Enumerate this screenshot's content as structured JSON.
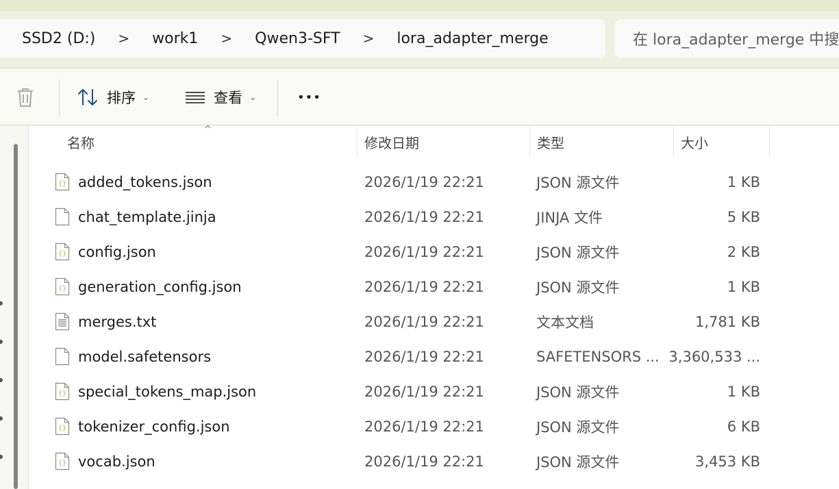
{
  "breadcrumb": [
    "SSD2 (D:)",
    "work1",
    "Qwen3-SFT",
    "lora_adapter_merge"
  ],
  "breadcrumb_separator": ">",
  "search": {
    "placeholder": "在 lora_adapter_merge 中搜"
  },
  "toolbar": {
    "sort_label": "排序",
    "view_label": "查看",
    "more_label": "•••"
  },
  "columns": {
    "name": "名称",
    "modified": "修改日期",
    "type": "类型",
    "size": "大小"
  },
  "files": [
    {
      "name": "added_tokens.json",
      "modified": "2026/1/19 22:21",
      "type": "JSON 源文件",
      "size": "1 KB",
      "icon": "json-file-icon"
    },
    {
      "name": "chat_template.jinja",
      "modified": "2026/1/19 22:21",
      "type": "JINJA 文件",
      "size": "5 KB",
      "icon": "blank-file-icon"
    },
    {
      "name": "config.json",
      "modified": "2026/1/19 22:21",
      "type": "JSON 源文件",
      "size": "2 KB",
      "icon": "json-file-icon"
    },
    {
      "name": "generation_config.json",
      "modified": "2026/1/19 22:21",
      "type": "JSON 源文件",
      "size": "1 KB",
      "icon": "json-file-icon"
    },
    {
      "name": "merges.txt",
      "modified": "2026/1/19 22:21",
      "type": "文本文档",
      "size": "1,781 KB",
      "icon": "text-file-icon"
    },
    {
      "name": "model.safetensors",
      "modified": "2026/1/19 22:21",
      "type": "SAFETENSORS ...",
      "size": "3,360,533 ...",
      "icon": "blank-file-icon"
    },
    {
      "name": "special_tokens_map.json",
      "modified": "2026/1/19 22:21",
      "type": "JSON 源文件",
      "size": "1 KB",
      "icon": "json-file-icon"
    },
    {
      "name": "tokenizer_config.json",
      "modified": "2026/1/19 22:21",
      "type": "JSON 源文件",
      "size": "6 KB",
      "icon": "json-file-icon"
    },
    {
      "name": "vocab.json",
      "modified": "2026/1/19 22:21",
      "type": "JSON 源文件",
      "size": "3,453 KB",
      "icon": "json-file-icon"
    }
  ],
  "colors": {
    "json_accent": "#b8b04a",
    "window_tint": "#eef0e2"
  }
}
